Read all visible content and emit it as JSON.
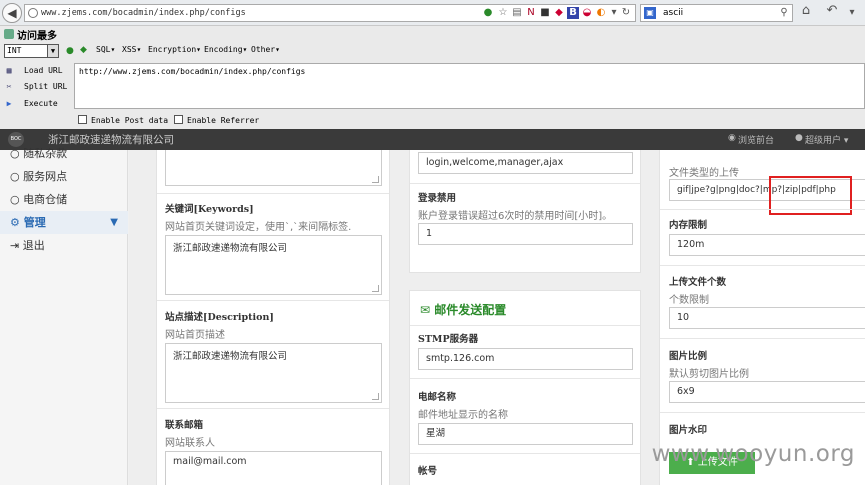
{
  "browser": {
    "url": "www.zjems.com/bocadmin/index.php/configs",
    "search_value": "ascii",
    "most_visited": "访问最多"
  },
  "hackbar": {
    "select_value": "INT",
    "menus": [
      "SQL▾",
      "XSS▾",
      "Encryption▾",
      "Encoding▾",
      "Other▾"
    ],
    "load_url": "Load URL",
    "split_url": "Split URL",
    "execute": "Execute",
    "url_text": "http://www.zjems.com/bocadmin/index.php/configs",
    "enable_post": "Enable Post data",
    "enable_referrer": "Enable Referrer"
  },
  "app": {
    "logo": "BOC",
    "brand": "浙江邮政速递物流有限公司",
    "view_front": "浏览前台",
    "super_user": "超级用户 ▾"
  },
  "sidebar": {
    "items": [
      "随私杂款",
      "服务网点",
      "电商仓储",
      "管理",
      "退出"
    ]
  },
  "col1": {
    "keywords_label": "关键词[Keywords]",
    "keywords_hint": "网站首页关键词设定，使用`,`来间隔标签.",
    "keywords_value": "浙江邮政速递物流有限公司",
    "desc_label": "站点描述[Description]",
    "desc_hint": "网站首页描述",
    "desc_value": "浙江邮政速递物流有限公司",
    "email_label": "联系邮箱",
    "email_hint": "网站联系人",
    "email_value": "mail@mail.com"
  },
  "col2": {
    "methods_value": "login,welcome,manager,ajax",
    "ban_label": "登录禁用",
    "ban_hint": "账户登录错误超过6次时的禁用时间[小时]。",
    "ban_value": "1",
    "mail_section_title": "邮件发送配置",
    "smtp_label": "STMP服务器",
    "smtp_value": "smtp.126.com",
    "sender_label": "电邮名称",
    "sender_hint": "邮件地址显示的名称",
    "sender_value": "星湖",
    "account_label": "帐号"
  },
  "col3": {
    "upload_hint": "文件类型的上传",
    "upload_types_value": "gif|jpe?g|png|doc?|mp?|zip|pdf|php",
    "memory_label": "内存限制",
    "memory_value": "120m",
    "count_label": "上传文件个数",
    "count_hint": "个数限制",
    "count_value": "10",
    "ratio_label": "图片比例",
    "ratio_hint": "默认剪切图片比例",
    "ratio_value": "6x9",
    "watermark_label": "图片水印",
    "upload_button": "上传文件"
  },
  "watermark": "www.wooyun.org",
  "colors": {
    "accent": "#2a6ab3",
    "header": "#3a3a3a",
    "green": "#4cae4c",
    "highlight": "#e02020"
  }
}
